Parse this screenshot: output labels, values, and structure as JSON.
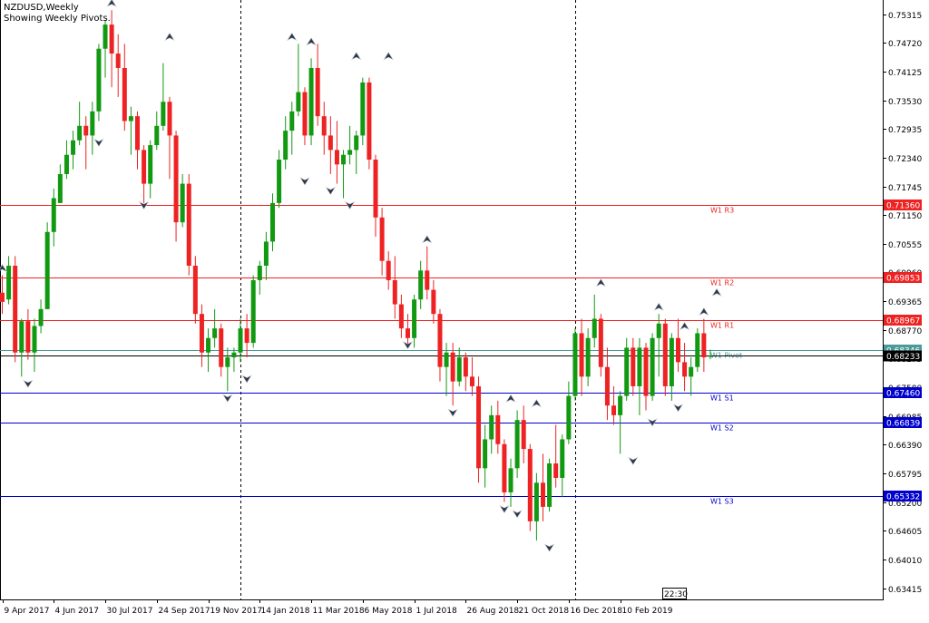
{
  "header": {
    "symbol_line": "NZDUSD,Weekly",
    "subtitle": "Showing Weekly Pivots."
  },
  "clock": "22:30",
  "colors": {
    "bull": "#119911",
    "bear": "#ee2222",
    "resistance": "#ee2222",
    "support": "#0000cc",
    "pivot": "#4a9a9a",
    "grid_dash": "#000000"
  },
  "chart_data": {
    "type": "candlestick",
    "title": "NZDUSD,Weekly",
    "ylim": [
      0.6318,
      0.7561
    ],
    "y_ticks": [
      "0.75315",
      "0.74720",
      "0.74125",
      "0.73530",
      "0.72935",
      "0.72340",
      "0.71745",
      "0.71150",
      "0.70555",
      "0.69960",
      "0.69365",
      "0.68770",
      "0.68175",
      "0.67580",
      "0.66985",
      "0.66390",
      "0.65795",
      "0.65200",
      "0.64605",
      "0.64010",
      "0.63415"
    ],
    "x_ticks": [
      "9 Apr 2017",
      "4 Jun 2017",
      "30 Jul 2017",
      "24 Sep 2017",
      "19 Nov 2017",
      "14 Jan 2018",
      "11 Mar 2018",
      "6 May 2018",
      "1 Jul 2018",
      "26 Aug 2018",
      "21 Oct 2018",
      "16 Dec 2018",
      "10 Feb 2019"
    ],
    "period_separators": [
      "1 Jan 2018",
      "1 Jan 2019"
    ],
    "current_price": "0.68233",
    "pivot_levels": [
      {
        "name": "W1 R3",
        "value": 0.7136,
        "price_label": "0.71360",
        "role": "resistance"
      },
      {
        "name": "W1 R2",
        "value": 0.69853,
        "price_label": "0.69853",
        "role": "resistance"
      },
      {
        "name": "W1 R1",
        "value": 0.68967,
        "price_label": "0.68967",
        "role": "resistance"
      },
      {
        "name": "W1 Pivot",
        "value": 0.68346,
        "price_label": "0.68346",
        "role": "pivot"
      },
      {
        "name": "W1 S1",
        "value": 0.6746,
        "price_label": "0.67460",
        "role": "support"
      },
      {
        "name": "W1 S2",
        "value": 0.66839,
        "price_label": "0.66839",
        "role": "support"
      },
      {
        "name": "W1 S3",
        "value": 0.65332,
        "price_label": "0.65332",
        "role": "support"
      }
    ],
    "candles": [
      [
        0.6954,
        0.699,
        0.691,
        0.6935
      ],
      [
        0.694,
        0.703,
        0.693,
        0.701
      ],
      [
        0.701,
        0.703,
        0.681,
        0.683
      ],
      [
        0.683,
        0.69,
        0.678,
        0.6895
      ],
      [
        0.6895,
        0.692,
        0.6815,
        0.683
      ],
      [
        0.683,
        0.69,
        0.679,
        0.6885
      ],
      [
        0.6885,
        0.694,
        0.687,
        0.692
      ],
      [
        0.692,
        0.71,
        0.692,
        0.708
      ],
      [
        0.708,
        0.717,
        0.705,
        0.715
      ],
      [
        0.714,
        0.722,
        0.714,
        0.72
      ],
      [
        0.72,
        0.727,
        0.719,
        0.724
      ],
      [
        0.724,
        0.729,
        0.721,
        0.727
      ],
      [
        0.727,
        0.735,
        0.726,
        0.73
      ],
      [
        0.73,
        0.732,
        0.721,
        0.728
      ],
      [
        0.728,
        0.735,
        0.724,
        0.733
      ],
      [
        0.733,
        0.747,
        0.731,
        0.746
      ],
      [
        0.746,
        0.752,
        0.74,
        0.751
      ],
      [
        0.751,
        0.754,
        0.738,
        0.745
      ],
      [
        0.745,
        0.749,
        0.736,
        0.742
      ],
      [
        0.742,
        0.747,
        0.729,
        0.731
      ],
      [
        0.731,
        0.734,
        0.724,
        0.732
      ],
      [
        0.732,
        0.733,
        0.721,
        0.725
      ],
      [
        0.725,
        0.726,
        0.714,
        0.718
      ],
      [
        0.718,
        0.727,
        0.715,
        0.726
      ],
      [
        0.726,
        0.733,
        0.725,
        0.73
      ],
      [
        0.73,
        0.743,
        0.729,
        0.735
      ],
      [
        0.735,
        0.736,
        0.719,
        0.728
      ],
      [
        0.728,
        0.729,
        0.706,
        0.71
      ],
      [
        0.71,
        0.72,
        0.709,
        0.718
      ],
      [
        0.718,
        0.72,
        0.699,
        0.701
      ],
      [
        0.701,
        0.703,
        0.689,
        0.691
      ],
      [
        0.691,
        0.693,
        0.68,
        0.683
      ],
      [
        0.683,
        0.688,
        0.679,
        0.686
      ],
      [
        0.686,
        0.692,
        0.684,
        0.688
      ],
      [
        0.688,
        0.689,
        0.678,
        0.68
      ],
      [
        0.68,
        0.684,
        0.675,
        0.682
      ],
      [
        0.682,
        0.684,
        0.679,
        0.683
      ],
      [
        0.683,
        0.69,
        0.681,
        0.688
      ],
      [
        0.688,
        0.691,
        0.682,
        0.685
      ],
      [
        0.685,
        0.699,
        0.684,
        0.698
      ],
      [
        0.698,
        0.702,
        0.695,
        0.701
      ],
      [
        0.701,
        0.708,
        0.698,
        0.706
      ],
      [
        0.706,
        0.716,
        0.704,
        0.714
      ],
      [
        0.714,
        0.725,
        0.713,
        0.723
      ],
      [
        0.723,
        0.732,
        0.721,
        0.729
      ],
      [
        0.729,
        0.735,
        0.724,
        0.733
      ],
      [
        0.733,
        0.747,
        0.732,
        0.737
      ],
      [
        0.737,
        0.738,
        0.726,
        0.728
      ],
      [
        0.728,
        0.744,
        0.726,
        0.742
      ],
      [
        0.742,
        0.747,
        0.73,
        0.732
      ],
      [
        0.732,
        0.735,
        0.724,
        0.728
      ],
      [
        0.728,
        0.732,
        0.72,
        0.725
      ],
      [
        0.725,
        0.731,
        0.718,
        0.722
      ],
      [
        0.722,
        0.725,
        0.715,
        0.724
      ],
      [
        0.724,
        0.73,
        0.722,
        0.725
      ],
      [
        0.725,
        0.729,
        0.72,
        0.728
      ],
      [
        0.728,
        0.74,
        0.726,
        0.739
      ],
      [
        0.739,
        0.74,
        0.721,
        0.723
      ],
      [
        0.723,
        0.724,
        0.707,
        0.711
      ],
      [
        0.711,
        0.713,
        0.699,
        0.702
      ],
      [
        0.702,
        0.704,
        0.696,
        0.698
      ],
      [
        0.698,
        0.703,
        0.69,
        0.693
      ],
      [
        0.693,
        0.695,
        0.686,
        0.688
      ],
      [
        0.688,
        0.691,
        0.684,
        0.686
      ],
      [
        0.686,
        0.695,
        0.684,
        0.694
      ],
      [
        0.694,
        0.702,
        0.692,
        0.7
      ],
      [
        0.7,
        0.705,
        0.694,
        0.696
      ],
      [
        0.696,
        0.698,
        0.689,
        0.691
      ],
      [
        0.691,
        0.692,
        0.677,
        0.68
      ],
      [
        0.68,
        0.685,
        0.674,
        0.683
      ],
      [
        0.683,
        0.685,
        0.672,
        0.677
      ],
      [
        0.677,
        0.684,
        0.676,
        0.682
      ],
      [
        0.682,
        0.683,
        0.675,
        0.678
      ],
      [
        0.678,
        0.682,
        0.674,
        0.676
      ],
      [
        0.676,
        0.678,
        0.656,
        0.659
      ],
      [
        0.659,
        0.668,
        0.655,
        0.665
      ],
      [
        0.665,
        0.672,
        0.662,
        0.67
      ],
      [
        0.67,
        0.673,
        0.662,
        0.664
      ],
      [
        0.664,
        0.665,
        0.652,
        0.654
      ],
      [
        0.654,
        0.661,
        0.651,
        0.659
      ],
      [
        0.659,
        0.671,
        0.657,
        0.669
      ],
      [
        0.669,
        0.672,
        0.66,
        0.663
      ],
      [
        0.663,
        0.664,
        0.646,
        0.648
      ],
      [
        0.648,
        0.658,
        0.644,
        0.656
      ],
      [
        0.656,
        0.662,
        0.648,
        0.651
      ],
      [
        0.651,
        0.661,
        0.65,
        0.66
      ],
      [
        0.66,
        0.668,
        0.655,
        0.657
      ],
      [
        0.657,
        0.666,
        0.653,
        0.665
      ],
      [
        0.665,
        0.677,
        0.664,
        0.674
      ],
      [
        0.674,
        0.688,
        0.673,
        0.687
      ],
      [
        0.687,
        0.69,
        0.674,
        0.678
      ],
      [
        0.678,
        0.688,
        0.676,
        0.686
      ],
      [
        0.686,
        0.695,
        0.684,
        0.69
      ],
      [
        0.69,
        0.691,
        0.678,
        0.68
      ],
      [
        0.68,
        0.684,
        0.669,
        0.672
      ],
      [
        0.672,
        0.676,
        0.668,
        0.67
      ],
      [
        0.67,
        0.675,
        0.662,
        0.674
      ],
      [
        0.674,
        0.686,
        0.673,
        0.684
      ],
      [
        0.684,
        0.686,
        0.674,
        0.676
      ],
      [
        0.676,
        0.686,
        0.67,
        0.684
      ],
      [
        0.684,
        0.685,
        0.671,
        0.674
      ],
      [
        0.674,
        0.687,
        0.673,
        0.686
      ],
      [
        0.686,
        0.691,
        0.678,
        0.689
      ],
      [
        0.689,
        0.69,
        0.674,
        0.676
      ],
      [
        0.676,
        0.687,
        0.673,
        0.686
      ],
      [
        0.686,
        0.69,
        0.679,
        0.681
      ],
      [
        0.681,
        0.685,
        0.675,
        0.678
      ],
      [
        0.678,
        0.682,
        0.674,
        0.68
      ],
      [
        0.68,
        0.688,
        0.679,
        0.687
      ],
      [
        0.687,
        0.69,
        0.679,
        0.682
      ],
      [
        0.6822,
        0.6836,
        0.6816,
        0.6823
      ]
    ],
    "fractals_up": [
      [
        0.699,
        0
      ],
      [
        0.754,
        17
      ],
      [
        0.747,
        26
      ],
      [
        0.747,
        45
      ],
      [
        0.746,
        48
      ],
      [
        0.743,
        55
      ],
      [
        0.743,
        60
      ],
      [
        0.705,
        66
      ],
      [
        0.672,
        79
      ],
      [
        0.671,
        83
      ],
      [
        0.696,
        93
      ],
      [
        0.691,
        102
      ],
      [
        0.687,
        106
      ],
      [
        0.69,
        109
      ],
      [
        0.694,
        111
      ]
    ],
    "fractals_down": [
      [
        0.678,
        4
      ],
      [
        0.728,
        15
      ],
      [
        0.715,
        22
      ],
      [
        0.675,
        35
      ],
      [
        0.679,
        38
      ],
      [
        0.72,
        47
      ],
      [
        0.718,
        51
      ],
      [
        0.715,
        54
      ],
      [
        0.686,
        63
      ],
      [
        0.672,
        70
      ],
      [
        0.652,
        78
      ],
      [
        0.651,
        80
      ],
      [
        0.644,
        85
      ],
      [
        0.662,
        98
      ],
      [
        0.67,
        101
      ],
      [
        0.673,
        105
      ]
    ]
  }
}
